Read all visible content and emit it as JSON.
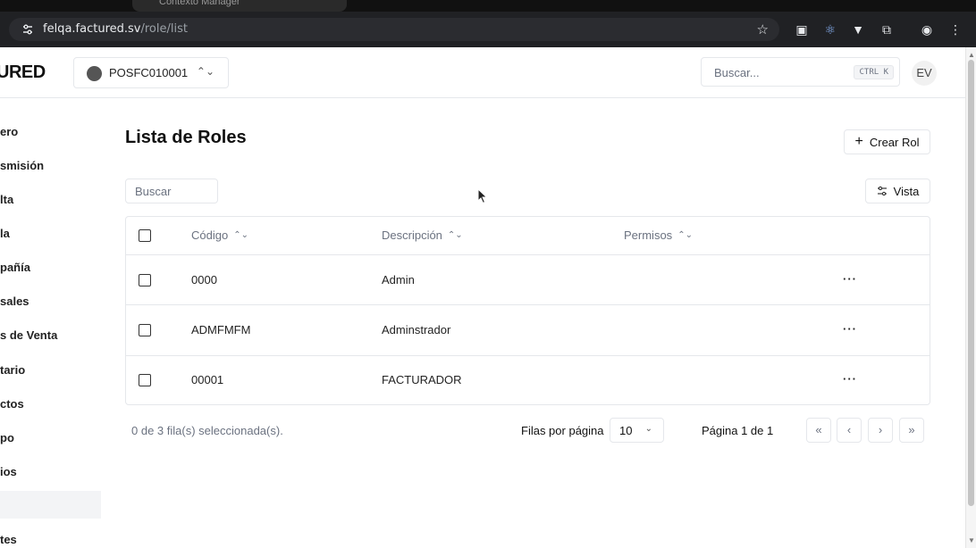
{
  "browser": {
    "tab_title": "Contexto Manager",
    "url_host": "felqa.factured.sv",
    "url_path": "/role/list"
  },
  "header": {
    "brand": "URED",
    "company": "POSFC010001",
    "search_placeholder": "Buscar...",
    "search_shortcut": "CTRL K",
    "avatar": "EV"
  },
  "sidebar": {
    "items": [
      {
        "label": "ero"
      },
      {
        "label": "smisión"
      },
      {
        "label": "lta"
      },
      {
        "label": "la"
      },
      {
        "label": "pañía"
      },
      {
        "label": "sales"
      },
      {
        "label": "s de Venta"
      },
      {
        "label": "tario"
      },
      {
        "label": "ctos"
      },
      {
        "label": "po"
      },
      {
        "label": "ios"
      },
      {
        "label": "tes"
      }
    ]
  },
  "page": {
    "title": "Lista de Roles",
    "create_label": "Crear Rol",
    "filter_placeholder": "Buscar",
    "view_label": "Vista"
  },
  "table": {
    "headers": {
      "code": "Código",
      "description": "Descripción",
      "permissions": "Permisos"
    },
    "rows": [
      {
        "code": "0000",
        "description": "Admin"
      },
      {
        "code": "ADMFMFM",
        "description": "Adminstrador"
      },
      {
        "code": "00001",
        "description": "FACTURADOR"
      }
    ],
    "actions_label": "···"
  },
  "footer": {
    "selected_count": "0 de 3 fila(s) seleccionada(s).",
    "rows_per_page_label": "Filas por página",
    "rows_per_page_value": "10",
    "page_info": "Página 1 de 1"
  }
}
